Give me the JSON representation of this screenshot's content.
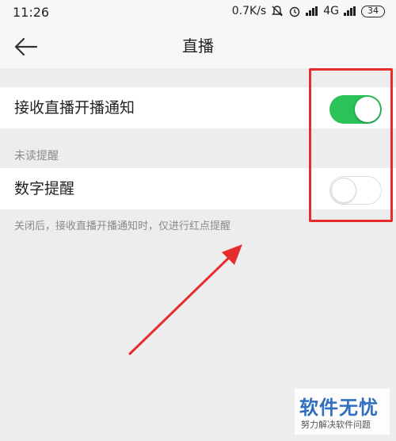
{
  "status_bar": {
    "time": "11:26",
    "speed": "0.7K/s",
    "network": "4G",
    "battery": "34",
    "icons": [
      "mute-bell-icon",
      "alarm-icon",
      "hd-signal-icon",
      "signal-icon",
      "battery-icon"
    ]
  },
  "header": {
    "title": "直播",
    "back_icon": "back-arrow-icon"
  },
  "settings": {
    "live_notice": {
      "label": "接收直播开播通知",
      "enabled": true
    },
    "unread_section_title": "未读提醒",
    "number_reminder": {
      "label": "数字提醒",
      "enabled": false
    },
    "hint": "关闭后，接收直播开播通知时，仅进行红点提醒"
  },
  "watermark": {
    "title": "软件无忧",
    "subtitle": "努力解决软件问题"
  },
  "colors": {
    "toggle_on": "#2bc25a",
    "annotation_red": "#e52d2d",
    "watermark_blue": "#2f6ec0"
  }
}
